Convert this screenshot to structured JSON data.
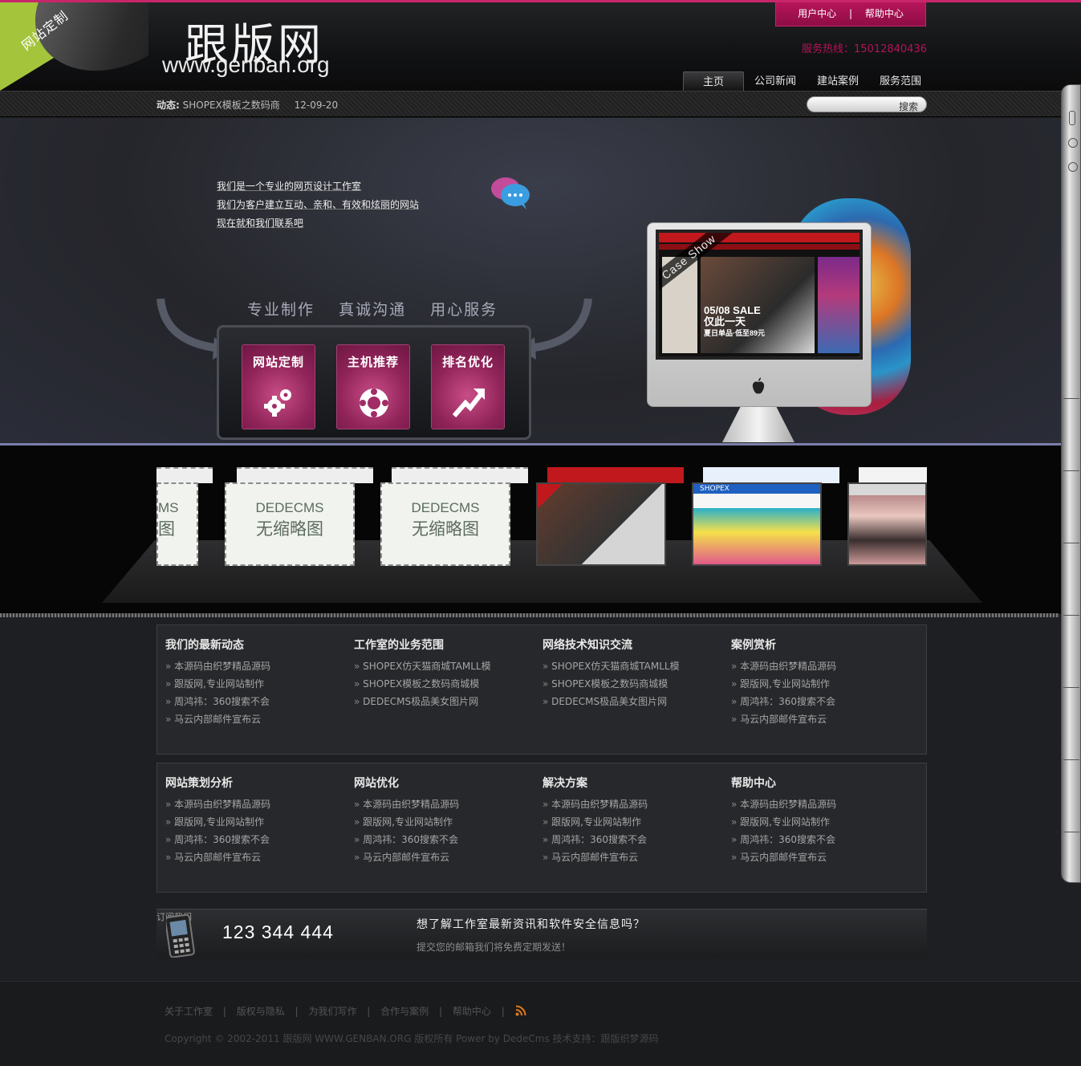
{
  "header": {
    "corner_badge": "网站定制",
    "logo_cn": "跟版网",
    "logo_en": "www.genban.org",
    "top_links": [
      "用户中心",
      "帮助中心"
    ],
    "top_links_separator": "|",
    "hotline": "服务热线：15012840436",
    "nav": [
      "主页",
      "公司新闻",
      "建站案例",
      "服务范围"
    ],
    "accent_color": "#c8266a"
  },
  "newsbar": {
    "label": "动态:",
    "headline": "SHOPEX模板之数码商",
    "date": "12-09-20",
    "search_button": "搜索",
    "search_placeholder": ""
  },
  "banner": {
    "intro": [
      "我们是一个专业的网页设计工作室",
      "我们为客户建立互动、亲和、有效和炫丽的网站",
      "现在就和我们联系吧"
    ],
    "slogans": [
      "专业制作",
      "真诚沟通",
      "用心服务"
    ],
    "services": [
      "网站定制",
      "主机推荐",
      "排名优化"
    ],
    "case_ribbon": "Case Show",
    "screen_sale": [
      "05/08 SALE",
      "仅此一天",
      "夏日单品·低至89元"
    ]
  },
  "gallery": {
    "placeholder_line1": "DEDECMS",
    "placeholder_line2": "无缩略图",
    "partial_line1": "MS",
    "partial_line2": "图",
    "photo_labels": [
      "SHOPEX"
    ]
  },
  "panels": [
    {
      "columns": [
        {
          "title": "我们的最新动态",
          "items": [
            "本源码由织梦精品源码",
            "跟版网,专业网站制作",
            "周鸿祎：360搜索不会",
            "马云内部邮件宣布云"
          ]
        },
        {
          "title": "工作室的业务范围",
          "items": [
            "SHOPEX仿天猫商城TAMLL模",
            "SHOPEX模板之数码商城模",
            "DEDECMS极品美女图片网"
          ]
        },
        {
          "title": "网络技术知识交流",
          "items": [
            "SHOPEX仿天猫商城TAMLL模",
            "SHOPEX模板之数码商城模",
            "DEDECMS极品美女图片网"
          ]
        },
        {
          "title": "案例赏析",
          "items": [
            "本源码由织梦精品源码",
            "跟版网,专业网站制作",
            "周鸿祎：360搜索不会",
            "马云内部邮件宣布云"
          ]
        }
      ]
    },
    {
      "columns": [
        {
          "title": "网站策划分析",
          "items": [
            "本源码由织梦精品源码",
            "跟版网,专业网站制作",
            "周鸿祎：360搜索不会",
            "马云内部邮件宣布云"
          ]
        },
        {
          "title": "网站优化",
          "items": [
            "本源码由织梦精品源码",
            "跟版网,专业网站制作",
            "周鸿祎：360搜索不会",
            "马云内部邮件宣布云"
          ]
        },
        {
          "title": "解决方案",
          "items": [
            "本源码由织梦精品源码",
            "跟版网,专业网站制作",
            "周鸿祎：360搜索不会",
            "马云内部邮件宣布云"
          ]
        },
        {
          "title": "帮助中心",
          "items": [
            "本源码由织梦精品源码",
            "跟版网,专业网站制作",
            "周鸿祎：360搜索不会",
            "马云内部邮件宣布云"
          ]
        }
      ]
    }
  ],
  "subscribe": {
    "label": "订阅我们",
    "number": "123 344 444",
    "title": "想了解工作室最新资讯和软件安全信息吗？",
    "desc": "提交您的邮箱我们将免费定期发送！"
  },
  "footer": {
    "links": [
      "关于工作室",
      "版权与隐私",
      "为我们写作",
      "合作与案例",
      "帮助中心"
    ],
    "separator": "|",
    "copyright": "Copyright © 2002-2011 跟版网 WWW.GENBAN.ORG 版权所有 Power by DedeCms 技术支持：跟版织梦源码",
    "rss_icon": "rss-icon",
    "rss_color": "#e07a1a"
  }
}
